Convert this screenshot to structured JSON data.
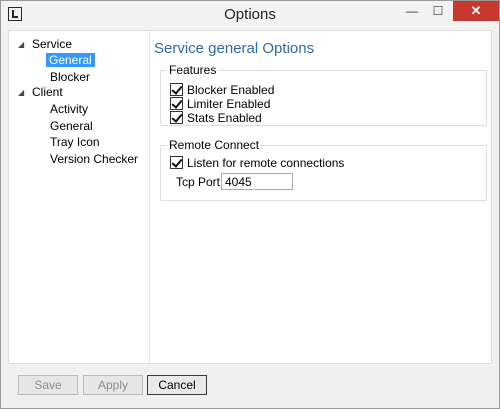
{
  "window": {
    "title": "Options",
    "minimize_glyph": "—",
    "maximize_glyph": "☐",
    "close_glyph": "✕"
  },
  "tree": {
    "service": {
      "label": "Service",
      "children": [
        "General",
        "Blocker"
      ]
    },
    "client": {
      "label": "Client",
      "children": [
        "Activity",
        "General",
        "Tray Icon",
        "Version Checker"
      ]
    },
    "selected": "General"
  },
  "panel": {
    "title": "Service general Options",
    "features": {
      "title": "Features",
      "items": [
        {
          "label": "Blocker Enabled",
          "checked": true
        },
        {
          "label": "Limiter Enabled",
          "checked": true
        },
        {
          "label": "Stats Enabled",
          "checked": true
        }
      ]
    },
    "remote": {
      "title": "Remote Connect",
      "listen": {
        "label": "Listen for remote connections",
        "checked": true
      },
      "port_label": "Tcp Port:",
      "port_value": "4045"
    }
  },
  "buttons": {
    "save": "Save",
    "apply": "Apply",
    "cancel": "Cancel"
  },
  "colors": {
    "accent": "#3399ff",
    "heading": "#2d6aa8",
    "close": "#c7392f"
  },
  "icons": {
    "app": "app-logo-icon",
    "expand": "expand-arrow-icon"
  }
}
